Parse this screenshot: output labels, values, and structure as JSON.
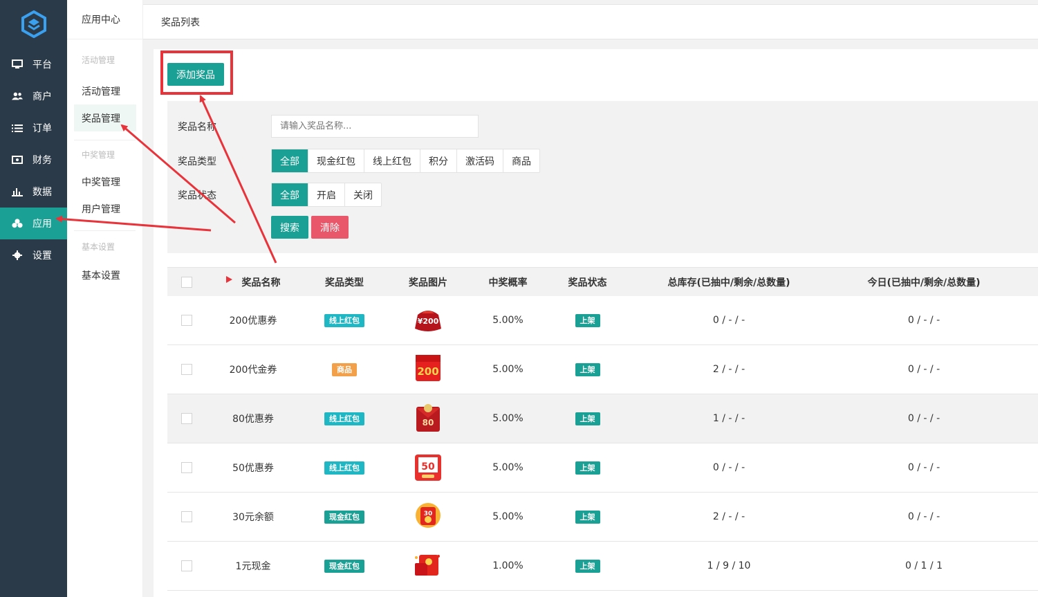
{
  "nav": {
    "items": [
      {
        "label": "平台",
        "icon": "monitor-icon"
      },
      {
        "label": "商户",
        "icon": "users-icon"
      },
      {
        "label": "订单",
        "icon": "list-icon"
      },
      {
        "label": "财务",
        "icon": "money-icon"
      },
      {
        "label": "数据",
        "icon": "bar-chart-icon"
      },
      {
        "label": "应用",
        "icon": "apps-icon"
      },
      {
        "label": "设置",
        "icon": "gear-icon"
      }
    ],
    "active_index": 5
  },
  "submenu": {
    "title": "应用中心",
    "group_activity": "活动管理",
    "item_activity": "活动管理",
    "item_prize": "奖品管理",
    "group_winning": "中奖管理",
    "item_winning": "中奖管理",
    "item_user": "用户管理",
    "group_basic": "基本设置",
    "item_basic": "基本设置"
  },
  "topbar": {
    "title": "奖品列表"
  },
  "toolbar": {
    "add_label": "添加奖品"
  },
  "filter": {
    "name_label": "奖品名称",
    "name_placeholder": "请输入奖品名称...",
    "type_label": "奖品类型",
    "type_options": [
      "全部",
      "现金红包",
      "线上红包",
      "积分",
      "激活码",
      "商品"
    ],
    "status_label": "奖品状态",
    "status_options": [
      "全部",
      "开启",
      "关闭"
    ],
    "search_label": "搜索",
    "clear_label": "清除"
  },
  "table": {
    "headers": [
      "奖品名称",
      "奖品类型",
      "奖品图片",
      "中奖概率",
      "奖品状态",
      "总库存(已抽中/剩余/总数量)",
      "今日(已抽中/剩余/总数量)"
    ],
    "rows": [
      {
        "name": "200优惠券",
        "type": "线上红包",
        "type_color": "#20b7c4",
        "image": "red-envelope-200",
        "rate": "5.00%",
        "status": "上架",
        "total": "0 / - / -",
        "today": "0 / - / -"
      },
      {
        "name": "200代金券",
        "type": "商品",
        "type_color": "#f2a04a",
        "image": "voucher-200",
        "rate": "5.00%",
        "status": "上架",
        "total": "2 / - / -",
        "today": "0 / - / -"
      },
      {
        "name": "80优惠券",
        "type": "线上红包",
        "type_color": "#20b7c4",
        "image": "red-envelope-80",
        "rate": "5.00%",
        "status": "上架",
        "total": "1 / - / -",
        "today": "0 / - / -"
      },
      {
        "name": "50优惠券",
        "type": "线上红包",
        "type_color": "#20b7c4",
        "image": "coupon-50",
        "rate": "5.00%",
        "status": "上架",
        "total": "0 / - / -",
        "today": "0 / - / -"
      },
      {
        "name": "30元余额",
        "type": "现金红包",
        "type_color": "#1aa094",
        "image": "balance-30",
        "rate": "5.00%",
        "status": "上架",
        "total": "2 / - / -",
        "today": "0 / - / -"
      },
      {
        "name": "1元现金",
        "type": "现金红包",
        "type_color": "#1aa094",
        "image": "cash-1",
        "rate": "1.00%",
        "status": "上架",
        "total": "1 / 9 / 10",
        "today": "0 / 1 / 1"
      }
    ]
  },
  "colors": {
    "accent": "#1aa094",
    "danger": "#e8576a",
    "annotation": "#e8333a",
    "nav_bg": "#2b3a48"
  }
}
